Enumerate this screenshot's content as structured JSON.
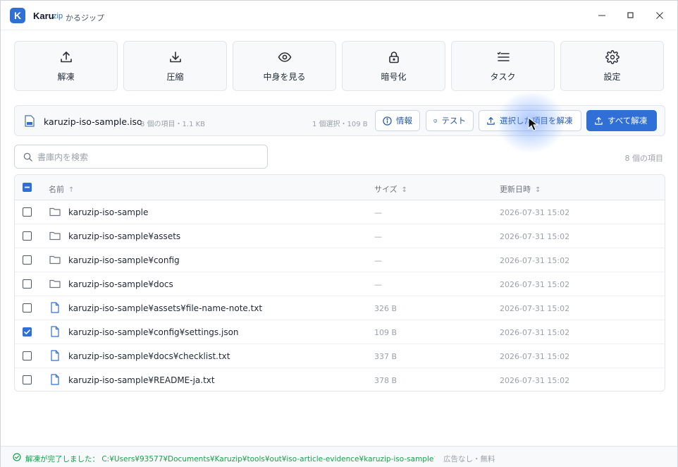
{
  "app": {
    "name": "Karu",
    "name_suffix": "zip",
    "subtitle": "かるジップ",
    "logo_letter": "K"
  },
  "toolbar": [
    {
      "label": "解凍",
      "icon": "upload-icon"
    },
    {
      "label": "圧縮",
      "icon": "download-icon"
    },
    {
      "label": "中身を見る",
      "icon": "eye-icon"
    },
    {
      "label": "暗号化",
      "icon": "lock-icon"
    },
    {
      "label": "タスク",
      "icon": "task-list-icon"
    },
    {
      "label": "設定",
      "icon": "gear-icon"
    }
  ],
  "archive": {
    "name": "karuzip-iso-sample.iso",
    "meta": "8 個の項目・1.1 KB",
    "selection": "1 個選択・109 B",
    "buttons": {
      "info": "情報",
      "test": "テスト",
      "extract_selected": "選択した項目を解凍",
      "extract_all": "すべて解凍"
    }
  },
  "search": {
    "placeholder": "書庫内を検索",
    "item_count": "8 個の項目"
  },
  "table": {
    "headers": {
      "name": "名前",
      "name_sort": "↑",
      "size": "サイズ",
      "size_sort": "↕",
      "date": "更新日時",
      "date_sort": "↕"
    },
    "rows": [
      {
        "name": "karuzip-iso-sample",
        "size": "—",
        "date": "2026-07-31 15:02",
        "type": "folder",
        "checked": false
      },
      {
        "name": "karuzip-iso-sample¥assets",
        "size": "—",
        "date": "2026-07-31 15:02",
        "type": "folder",
        "checked": false
      },
      {
        "name": "karuzip-iso-sample¥config",
        "size": "—",
        "date": "2026-07-31 15:02",
        "type": "folder",
        "checked": false
      },
      {
        "name": "karuzip-iso-sample¥docs",
        "size": "—",
        "date": "2026-07-31 15:02",
        "type": "folder",
        "checked": false
      },
      {
        "name": "karuzip-iso-sample¥assets¥file-name-note.txt",
        "size": "326 B",
        "date": "2026-07-31 15:02",
        "type": "file",
        "checked": false
      },
      {
        "name": "karuzip-iso-sample¥config¥settings.json",
        "size": "109 B",
        "date": "2026-07-31 15:02",
        "type": "file",
        "checked": true
      },
      {
        "name": "karuzip-iso-sample¥docs¥checklist.txt",
        "size": "337 B",
        "date": "2026-07-31 15:02",
        "type": "file",
        "checked": false
      },
      {
        "name": "karuzip-iso-sample¥README-ja.txt",
        "size": "378 B",
        "date": "2026-07-31 15:02",
        "type": "file",
        "checked": false
      }
    ]
  },
  "status": {
    "message": "解凍が完了しました： C:¥Users¥93577¥Documents¥Karuzip¥tools¥out¥iso-article-evidence¥karuzip-iso-sample",
    "separator": "·",
    "ad_text": "広告なし・無料"
  },
  "colors": {
    "accent": "#2f6fd6",
    "success": "#16a34a",
    "muted": "#9aa1ab"
  }
}
